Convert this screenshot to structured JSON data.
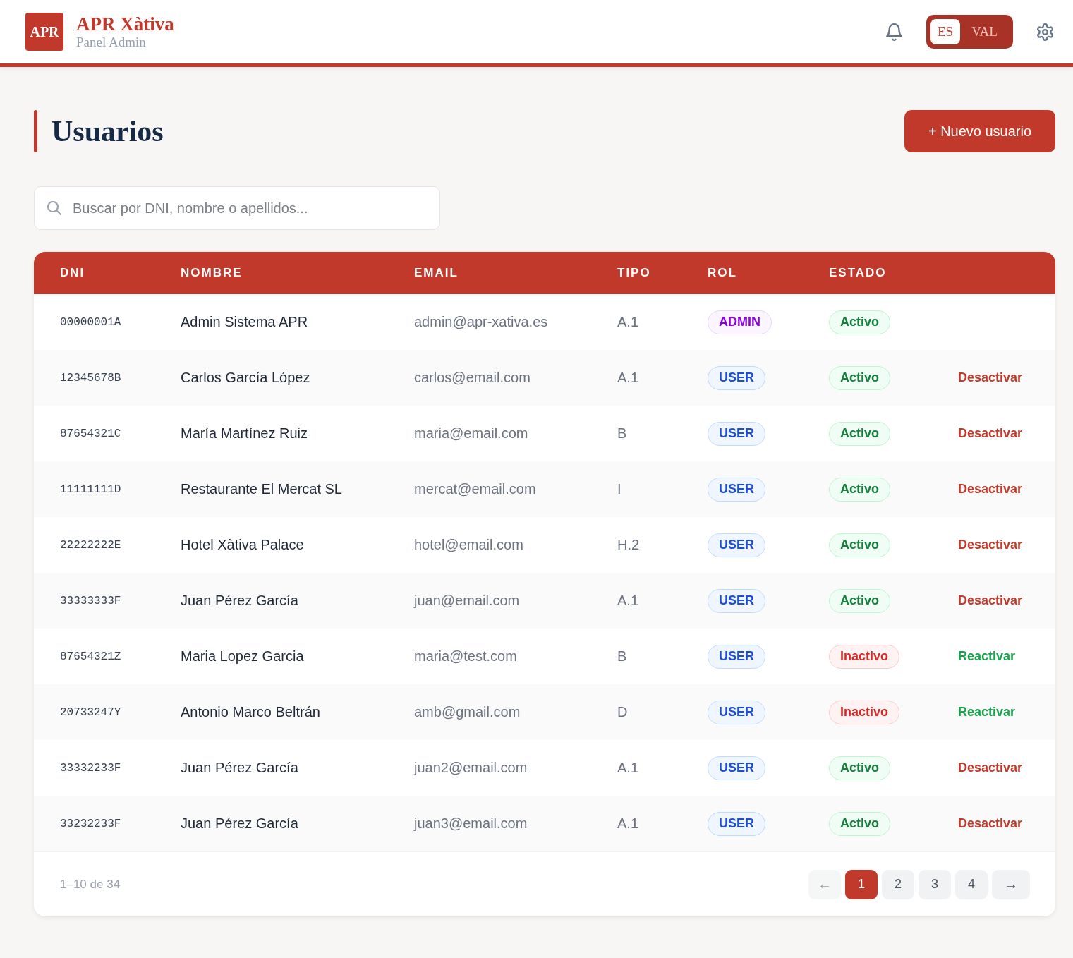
{
  "header": {
    "logo": "APR",
    "title": "APR Xàtiva",
    "subtitle": "Panel Admin",
    "languages": [
      {
        "label": "ES",
        "selected": true
      },
      {
        "label": "VAL",
        "selected": false
      }
    ]
  },
  "page": {
    "title": "Usuarios",
    "new_button": "+ Nuevo usuario"
  },
  "search": {
    "placeholder": "Buscar por DNI, nombre o apellidos..."
  },
  "table": {
    "columns": [
      "DNI",
      "NOMBRE",
      "EMAIL",
      "TIPO",
      "ROL",
      "ESTADO"
    ],
    "rows": [
      {
        "dni": "00000001A",
        "name": "Admin Sistema APR",
        "email": "admin@apr-xativa.es",
        "type": "A.1",
        "role": {
          "label": "ADMIN",
          "kind": "admin"
        },
        "status": {
          "label": "Activo",
          "active": true
        }
      },
      {
        "dni": "12345678B",
        "name": "Carlos García López",
        "email": "carlos@email.com",
        "type": "A.1",
        "role": {
          "label": "USER",
          "kind": "user"
        },
        "status": {
          "label": "Activo",
          "active": true
        },
        "action": {
          "label": "Desactivar",
          "kind": "deactivate"
        }
      },
      {
        "dni": "87654321C",
        "name": "María Martínez Ruiz",
        "email": "maria@email.com",
        "type": "B",
        "role": {
          "label": "USER",
          "kind": "user"
        },
        "status": {
          "label": "Activo",
          "active": true
        },
        "action": {
          "label": "Desactivar",
          "kind": "deactivate"
        }
      },
      {
        "dni": "11111111D",
        "name": "Restaurante El Mercat SL",
        "email": "mercat@email.com",
        "type": "I",
        "role": {
          "label": "USER",
          "kind": "user"
        },
        "status": {
          "label": "Activo",
          "active": true
        },
        "action": {
          "label": "Desactivar",
          "kind": "deactivate"
        }
      },
      {
        "dni": "22222222E",
        "name": "Hotel Xàtiva Palace",
        "email": "hotel@email.com",
        "type": "H.2",
        "role": {
          "label": "USER",
          "kind": "user"
        },
        "status": {
          "label": "Activo",
          "active": true
        },
        "action": {
          "label": "Desactivar",
          "kind": "deactivate"
        }
      },
      {
        "dni": "33333333F",
        "name": "Juan Pérez García",
        "email": "juan@email.com",
        "type": "A.1",
        "role": {
          "label": "USER",
          "kind": "user"
        },
        "status": {
          "label": "Activo",
          "active": true
        },
        "action": {
          "label": "Desactivar",
          "kind": "deactivate"
        }
      },
      {
        "dni": "87654321Z",
        "name": "Maria Lopez Garcia",
        "email": "maria@test.com",
        "type": "B",
        "role": {
          "label": "USER",
          "kind": "user"
        },
        "status": {
          "label": "Inactivo",
          "active": false
        },
        "action": {
          "label": "Reactivar",
          "kind": "reactivate"
        }
      },
      {
        "dni": "20733247Y",
        "name": "Antonio Marco Beltrán",
        "email": "amb@gmail.com",
        "type": "D",
        "role": {
          "label": "USER",
          "kind": "user"
        },
        "status": {
          "label": "Inactivo",
          "active": false
        },
        "action": {
          "label": "Reactivar",
          "kind": "reactivate"
        }
      },
      {
        "dni": "33332233F",
        "name": "Juan Pérez García",
        "email": "juan2@email.com",
        "type": "A.1",
        "role": {
          "label": "USER",
          "kind": "user"
        },
        "status": {
          "label": "Activo",
          "active": true
        },
        "action": {
          "label": "Desactivar",
          "kind": "deactivate"
        }
      },
      {
        "dni": "33232233F",
        "name": "Juan Pérez García",
        "email": "juan3@email.com",
        "type": "A.1",
        "role": {
          "label": "USER",
          "kind": "user"
        },
        "status": {
          "label": "Activo",
          "active": true
        },
        "action": {
          "label": "Desactivar",
          "kind": "deactivate"
        }
      }
    ]
  },
  "pagination": {
    "summary": "1–10 de 34",
    "prev": {
      "label": "←",
      "disabled": true
    },
    "pages": [
      {
        "label": "1",
        "selected": true
      },
      {
        "label": "2",
        "selected": false
      },
      {
        "label": "3",
        "selected": false
      },
      {
        "label": "4",
        "selected": false
      }
    ],
    "next": {
      "label": "→",
      "disabled": false
    }
  }
}
